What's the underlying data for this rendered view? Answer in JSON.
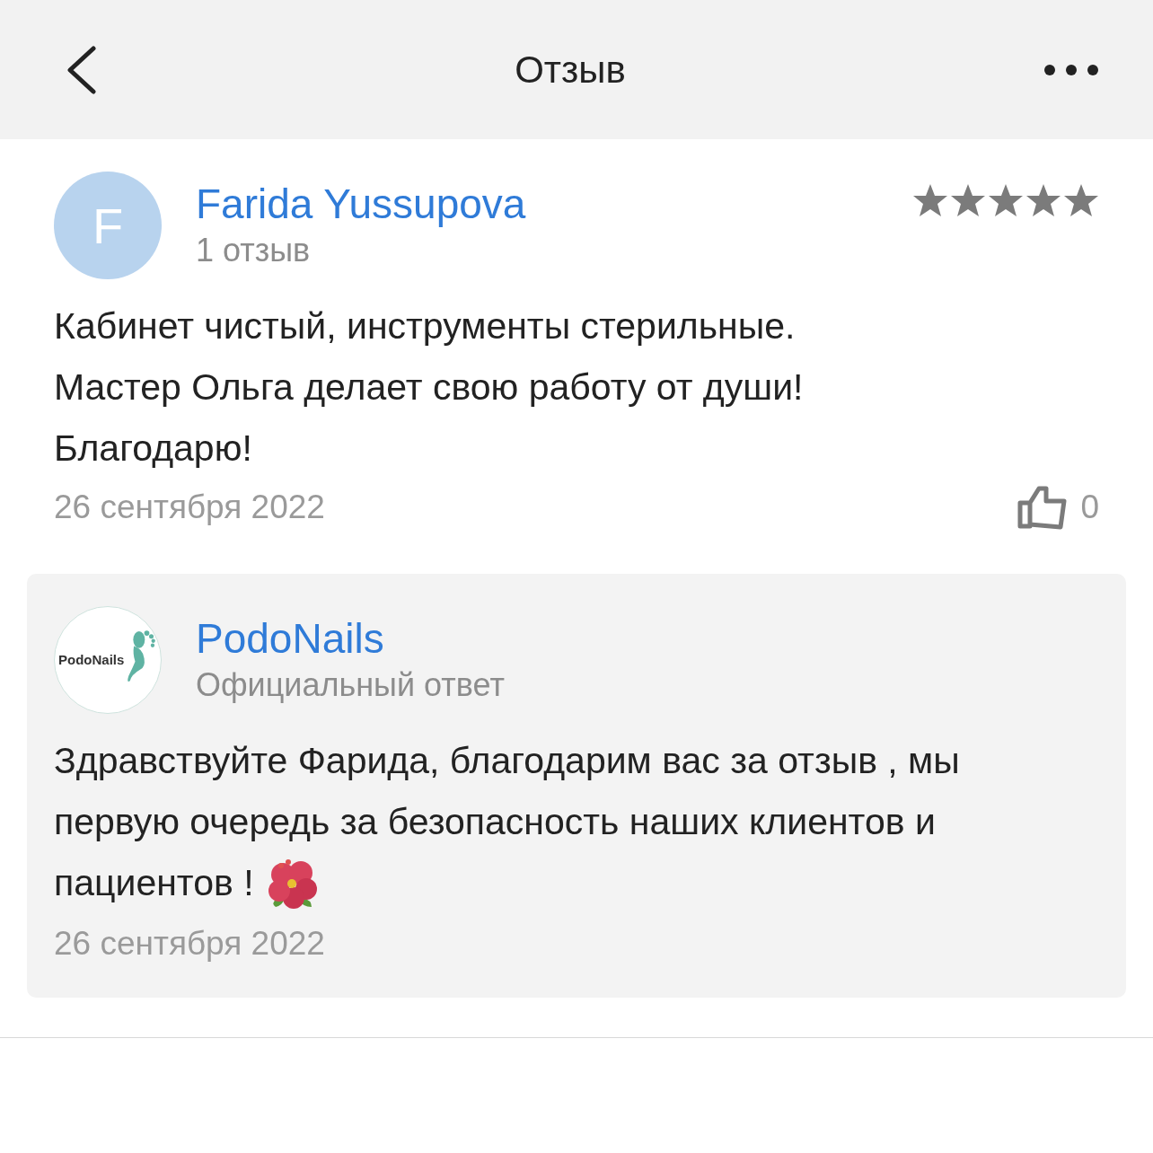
{
  "header": {
    "title": "Отзыв"
  },
  "review": {
    "avatar_letter": "F",
    "author": "Farida Yussupova",
    "reviews_count": "1 отзыв",
    "stars": 5,
    "text_lines": [
      "Кабинет чистый, инструменты стерильные.",
      "Мастер Ольга делает свою работу от души!",
      "Благодарю!"
    ],
    "date": "26 сентября 2022",
    "likes": "0"
  },
  "reply": {
    "logo_text": "PodoNails",
    "author": "PodoNails",
    "label": "Официальный ответ",
    "text_lines": [
      "Здравствуйте Фарида, благодарим вас за отзыв , мы",
      "первую очередь за безопасность наших клиентов и",
      "пациентов !"
    ],
    "date": "26 сентября 2022"
  }
}
